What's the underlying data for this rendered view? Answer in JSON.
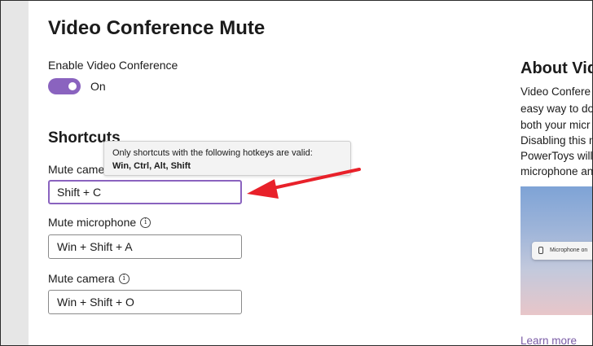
{
  "page": {
    "title": "Video Conference Mute"
  },
  "enable": {
    "label": "Enable Video Conference",
    "state": "On",
    "on": true
  },
  "shortcuts": {
    "heading": "Shortcuts",
    "tooltip": {
      "text": "Only shortcuts with the following hotkeys are valid:",
      "keys": "Win, Ctrl, Alt, Shift"
    },
    "items": [
      {
        "label": "Mute camera & microphone",
        "value": "Shift + C"
      },
      {
        "label": "Mute microphone",
        "value": "Win + Shift + A"
      },
      {
        "label": "Mute camera",
        "value": "Win + Shift + O"
      }
    ]
  },
  "about": {
    "title": "About Vide",
    "lines": [
      "Video Confere",
      "easy way to do",
      "both your micr",
      "Disabling this m",
      "PowerToys will",
      "microphone an"
    ],
    "image_caption": "Microphone on",
    "learn_more": "Learn more"
  },
  "colors": {
    "accent": "#8a63bf",
    "annotation_arrow": "#e8212a"
  },
  "icons": {
    "info": "info-circle-icon",
    "mic": "microphone-icon"
  }
}
